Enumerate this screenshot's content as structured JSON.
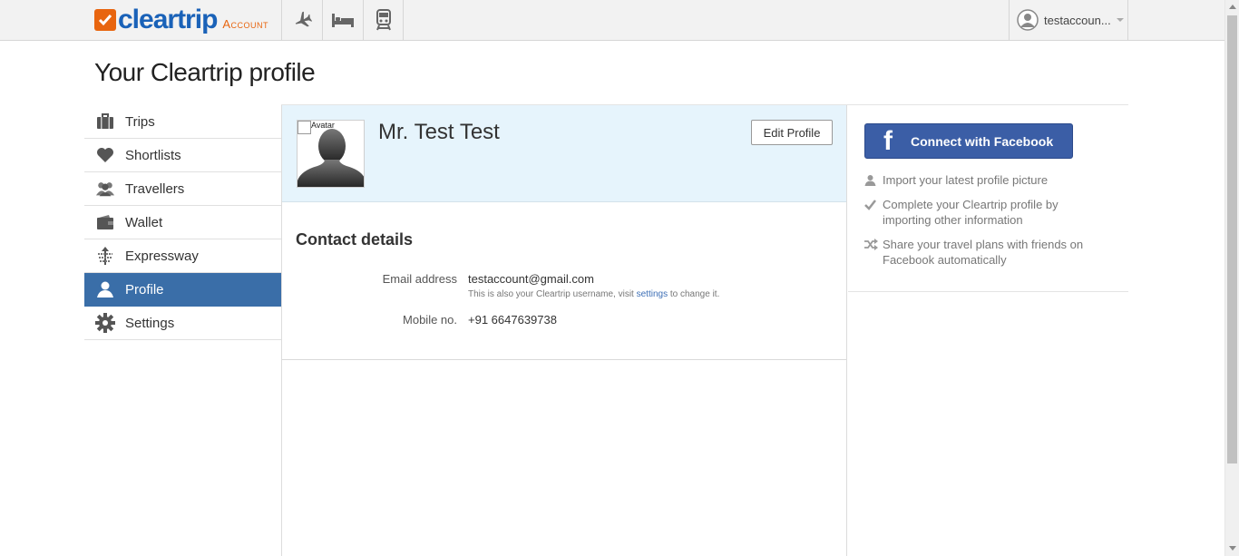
{
  "header": {
    "logo_text": "cleartrip",
    "logo_sub": "Account",
    "nav": [
      {
        "icon": "flight-icon"
      },
      {
        "icon": "hotel-icon"
      },
      {
        "icon": "train-icon"
      }
    ],
    "account_name": "testaccoun..."
  },
  "page": {
    "title": "Your Cleartrip profile"
  },
  "sidebar": {
    "items": [
      {
        "label": "Trips",
        "icon": "briefcase-icon"
      },
      {
        "label": "Shortlists",
        "icon": "heart-icon"
      },
      {
        "label": "Travellers",
        "icon": "people-icon"
      },
      {
        "label": "Wallet",
        "icon": "wallet-icon"
      },
      {
        "label": "Expressway",
        "icon": "expressway-icon"
      },
      {
        "label": "Profile",
        "icon": "user-icon",
        "active": true
      },
      {
        "label": "Settings",
        "icon": "gear-icon"
      }
    ]
  },
  "profile": {
    "avatar_alt": "Avatar",
    "name": "Mr. Test Test",
    "edit_label": "Edit Profile"
  },
  "contact": {
    "heading": "Contact details",
    "email_label": "Email address",
    "email_value": "testaccount@gmail.com",
    "email_hint_pre": "This is also your Cleartrip username, visit",
    "email_hint_link": "settings",
    "email_hint_post": "to change it.",
    "mobile_label": "Mobile no.",
    "mobile_value": "+91 6647639738"
  },
  "facebook": {
    "button_label": "Connect with Facebook",
    "items": [
      {
        "text": "Import your latest profile picture",
        "icon": "person-icon"
      },
      {
        "text": "Complete your Cleartrip profile by importing other information",
        "icon": "check-icon"
      },
      {
        "text": "Share your travel plans with friends on Facebook automatically",
        "icon": "shuffle-icon"
      }
    ]
  },
  "colors": {
    "brand_orange": "#e8650f",
    "brand_blue": "#1a62b8",
    "active_nav": "#3a6ea8",
    "facebook_blue": "#3b5ea6",
    "profile_header_bg": "#e6f4fc"
  }
}
